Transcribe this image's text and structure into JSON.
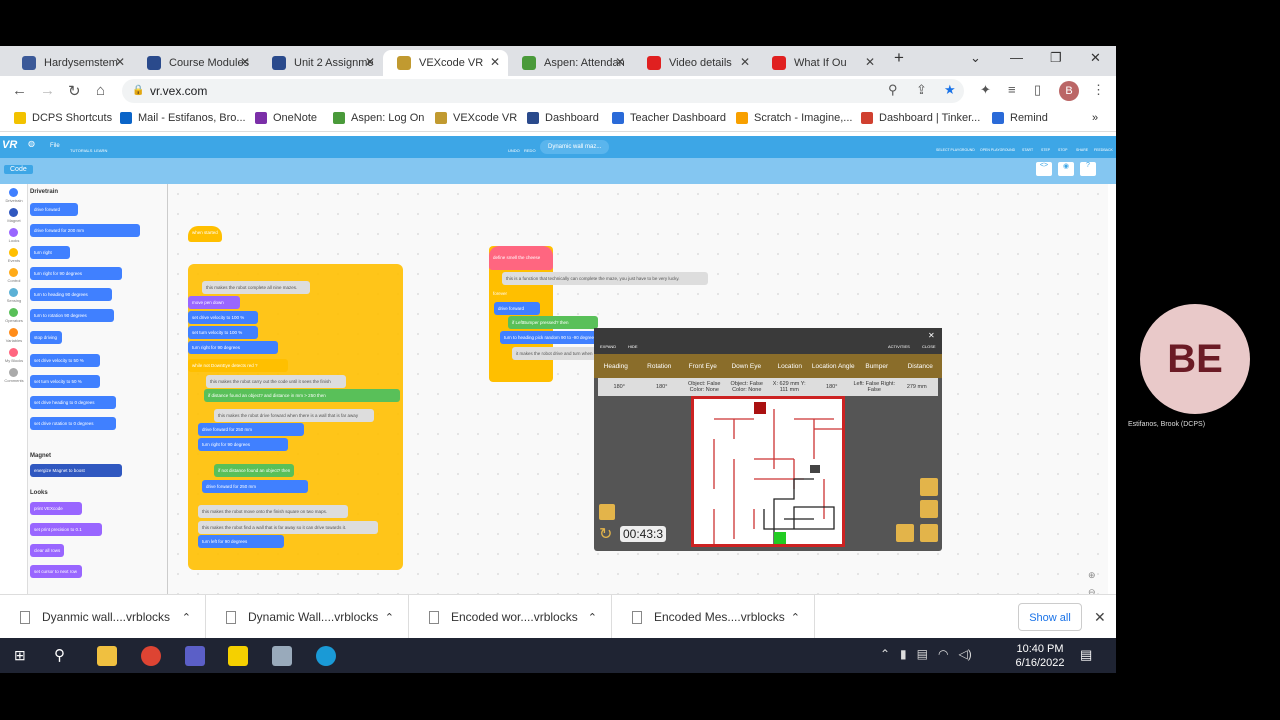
{
  "tabs": [
    {
      "label": "Hardysemstem",
      "color": "#3b5998"
    },
    {
      "label": "Course Modules",
      "color": "#2a4a8c"
    },
    {
      "label": "Unit 2 Assignments",
      "color": "#2a4a8c"
    },
    {
      "label": "VEXcode VR",
      "color": "#c19a30"
    },
    {
      "label": "Aspen: Attendance",
      "color": "#4a9a3a"
    },
    {
      "label": "Video details",
      "color": "#e02020"
    },
    {
      "label": "What If Ou",
      "color": "#e02020"
    }
  ],
  "address": {
    "url": "vr.vex.com"
  },
  "bookmarks": [
    "DCPS Shortcuts",
    "Mail - Estifanos, Bro...",
    "OneNote",
    "Aspen: Log On",
    "VEXcode VR",
    "Dashboard",
    "Teacher Dashboard",
    "Scratch - Imagine,...",
    "Dashboard | Tinker...",
    "Remind"
  ],
  "vex": {
    "logo": "VR",
    "file": "File",
    "tutorials": "TUTORIALS",
    "learn": "LEARN",
    "undo": "UNDO",
    "redo": "REDO",
    "project": "Dynamic wall maz...",
    "select_playground": "SELECT PLAYGROUND",
    "open_playground": "OPEN PLAYGROUND",
    "start": "START",
    "step": "STEP",
    "stop": "STOP",
    "share": "SHARE",
    "feedback": "FEEDBACK",
    "code_label": "Code"
  },
  "categories": [
    {
      "name": "Drivetrain",
      "color": "#4080ff"
    },
    {
      "name": "Magnet",
      "color": "#3058c0"
    },
    {
      "name": "Looks",
      "color": "#9966ff"
    },
    {
      "name": "Events",
      "color": "#ffbf00"
    },
    {
      "name": "Control",
      "color": "#ffab19"
    },
    {
      "name": "Sensing",
      "color": "#5cb1d6"
    },
    {
      "name": "Operators",
      "color": "#59c059"
    },
    {
      "name": "Variables",
      "color": "#ff8c1a"
    },
    {
      "name": "My Blocks",
      "color": "#ff6680"
    },
    {
      "name": "Comments",
      "color": "#aaaaaa"
    }
  ],
  "palette": {
    "drivetrain": "Drivetrain",
    "magnet": "Magnet",
    "looks": "Looks",
    "blocks": [
      "drive forward",
      "drive forward for 200 mm",
      "turn right",
      "turn right for 90 degrees",
      "turn to heading 90 degrees",
      "turn to rotation 90 degrees",
      "stop driving",
      "set drive velocity to 50 %",
      "set turn velocity to 50 %",
      "set drive heading to 0 degrees",
      "set drive rotation to 0 degrees"
    ],
    "magnet_blocks": [
      "energize Magnet to boost"
    ],
    "looks_blocks": [
      "print VEXcode",
      "set print precision to 0.1",
      "clear all rows",
      "set cursor to next row"
    ]
  },
  "script": {
    "hat": "when started",
    "lines": [
      "this makes the robot complete all nine mazes.",
      "move pen down",
      "set drive velocity to 100 %",
      "set turn velocity to 100 %",
      "turn right for 90 degrees",
      "while not DownEye detects red ?",
      "this makes the robot carry out the code until it sees the finish",
      "if distance found an object? and distance in mm > 250 then",
      "this makes the robot drive forward when there is a wall that is far away",
      "drive forward for 250 mm",
      "turn right for 90 degrees",
      "if not distance found an object? then",
      "drive forward for 250 mm",
      "this makes the robot move onto the finish square on two maps.",
      "this makes the robot find a wall that is far away so it can drive towards it.",
      "turn left for 90 degrees"
    ]
  },
  "func": {
    "define": "define smell the cheese",
    "lines": [
      "this is a function that technically can complete the maze, you just have to be very lucky.",
      "forever",
      "drive forward",
      "if LeftBumper pressed? then",
      "turn to heading pick random 90 to -90 degrees",
      "it makes the robot drive and turn when it hits a wall."
    ]
  },
  "dash": {
    "expand": "EXPAND",
    "hide": "HIDE",
    "activities": "ACTIVITIES",
    "close": "CLOSE",
    "headers": [
      "Heading",
      "Rotation",
      "Front Eye",
      "Down Eye",
      "Location",
      "Location Angle",
      "Bumper",
      "Distance"
    ],
    "values": [
      "180°",
      "180°",
      "Object: False Color: None",
      "Object: False Color: None",
      "X: 629 mm Y: 111 mm",
      "180°",
      "Left: False Right: False",
      "279 mm"
    ],
    "timer": "00:43:3"
  },
  "downloads": [
    "Dyanmic wall....vrblocks",
    "Dynamic Wall....vrblocks",
    "Encoded wor....vrblocks",
    "Encoded Mes....vrblocks"
  ],
  "show_all": "Show all",
  "clock": {
    "time": "10:40 PM",
    "date": "6/16/2022"
  },
  "caller": {
    "initials": "BE",
    "name": "Estifanos, Brook (DCPS)"
  }
}
